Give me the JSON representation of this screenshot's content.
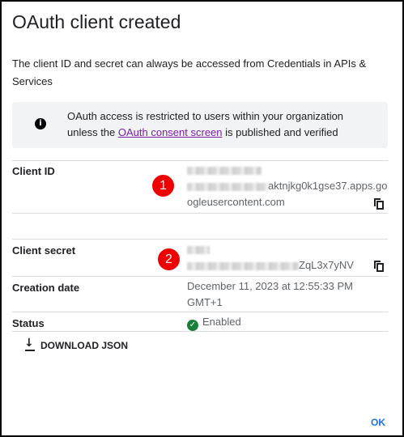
{
  "dialog": {
    "title": "OAuth client created",
    "description": "The client ID and secret can always be accessed from Credentials in APIs & Services",
    "info": {
      "icon": "info-icon",
      "text_before": "OAuth access is restricted to users within your organization unless the ",
      "link_text": "OAuth consent screen",
      "text_after": " is published and verified"
    },
    "client_id": {
      "label": "Client ID",
      "value_line1_suffix": "aktnjkg0k1gse37.apps.go",
      "value_line2": "ogleusercontent.com",
      "copy_icon": "copy-icon",
      "badge": "1"
    },
    "client_secret": {
      "label": "Client secret",
      "value_suffix": "ZqL3x7yNV",
      "copy_icon": "copy-icon",
      "badge": "2"
    },
    "creation_date": {
      "label": "Creation date",
      "value_line1": "December 11, 2023 at 12:55:33 PM",
      "value_line2": "GMT+1"
    },
    "status": {
      "label": "Status",
      "value": "Enabled",
      "icon": "check-circle-icon"
    },
    "download_label": "DOWNLOAD JSON",
    "ok_label": "OK"
  },
  "colors": {
    "link": "#7b1fa2",
    "accent": "#1a73e8",
    "badge": "#ee0000",
    "status_ok": "#188038"
  }
}
